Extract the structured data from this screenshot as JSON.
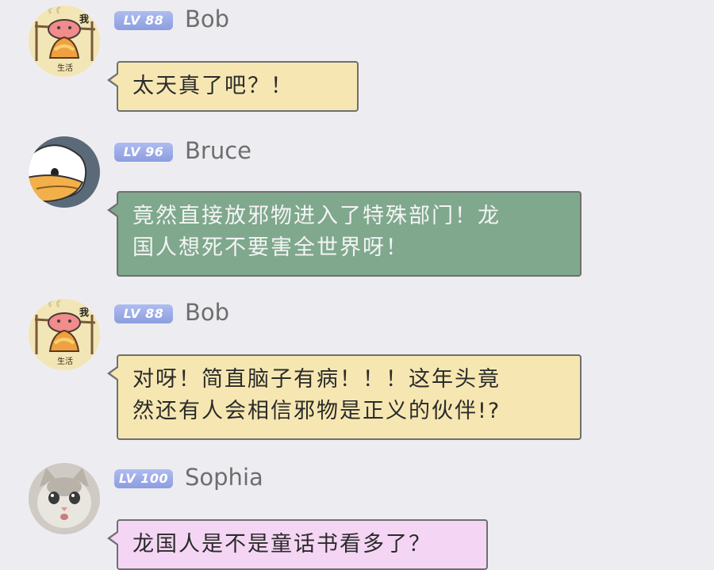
{
  "messages": [
    {
      "avatar": "chef-cat-avatar",
      "avatar_text": "生活",
      "avatar_tag": "我",
      "level": "LV 88",
      "username": "Bob",
      "bubble_color": "#f6e7b2",
      "lines": [
        "太天真了吧？！"
      ]
    },
    {
      "avatar": "duck-avatar",
      "level": "LV 96",
      "username": "Bruce",
      "bubble_color": "#7fa88d",
      "lines": [
        "竟然直接放邪物进入了特殊部门！龙",
        "国人想死不要害全世界呀！"
      ]
    },
    {
      "avatar": "chef-cat-avatar",
      "avatar_text": "生活",
      "avatar_tag": "我",
      "level": "LV 88",
      "username": "Bob",
      "bubble_color": "#f6e7b2",
      "lines": [
        "对呀！简直脑子有病！！！这年头竟",
        "然还有人会相信邪物是正义的伙伴!?"
      ]
    },
    {
      "avatar": "kitten-photo-avatar",
      "level": "LV 100",
      "username": "Sophia",
      "bubble_color": "#f4d6f4",
      "lines": [
        "龙国人是不是童话书看多了？"
      ]
    }
  ],
  "colors": {
    "background": "#ededf1",
    "level_badge": "#9aa9e6",
    "username_text": "#6e6e6e",
    "bubble_border": "#6f6f6f"
  }
}
